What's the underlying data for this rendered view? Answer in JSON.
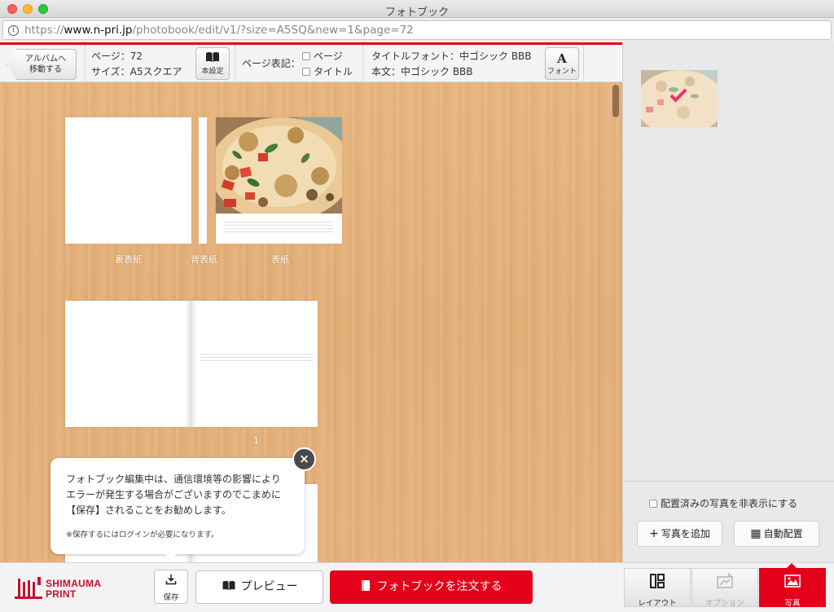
{
  "window": {
    "title": "フォトブック"
  },
  "browser": {
    "url_scheme": "https://",
    "url_host": "www.n-pri.jp",
    "url_path": "/photobook/edit/v1/?size=A5SQ&new=1&page=72"
  },
  "toolbar": {
    "back_line1": "アルバムへ",
    "back_line2": "移動する",
    "pages": "ページ：72",
    "size": "サイズ：A5スクエア",
    "book_settings": "本設定",
    "page_notation_label": "ページ表記：",
    "option_page": "ページ",
    "option_title": "タイトル",
    "title_font": "タイトルフォント：中ゴシック BBB",
    "body_font": "本文：中ゴシック BBB",
    "font_button": "フォント",
    "font_button_glyph": "A"
  },
  "canvas": {
    "cover_labels": {
      "back": "裏表紙",
      "spine": "背表紙",
      "front": "表紙"
    },
    "spread_page_number": "1"
  },
  "tooltip": {
    "line1": "フォトブック編集中は、通信環境等の影響により",
    "line2": "エラーが発生する場合がございますのでこまめに",
    "line3": "【保存】されることをお勧めします。",
    "note": "※保存するにはログインが必要になります。",
    "close_glyph": "×"
  },
  "right_panel": {
    "hide_placed_label": "配置済みの写真を非表示にする",
    "add_photo": "写真を追加",
    "auto_place": "自動配置"
  },
  "bottom": {
    "logo_line1": "SHIMAUMA",
    "logo_line2": "PRINT",
    "save": "保存",
    "preview": "プレビュー",
    "order": "フォトブックを注文する",
    "tabs": [
      {
        "label": "レイアウト",
        "icon": "layout-icon",
        "state": "normal"
      },
      {
        "label": "オプション",
        "icon": "option-icon",
        "state": "disabled"
      },
      {
        "label": "写真",
        "icon": "photo-icon",
        "state": "active"
      }
    ]
  },
  "colors": {
    "brand_red": "#e4001b",
    "wood": "#e5b079",
    "check_pink": "#e8356a"
  }
}
